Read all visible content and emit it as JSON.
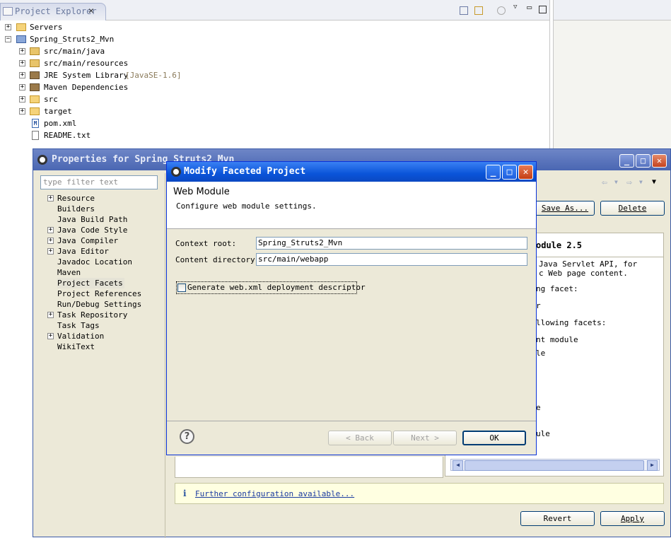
{
  "project_explorer": {
    "tab_label": "Project Explorer",
    "close_glyph": "✕",
    "tree": [
      {
        "label": "Servers",
        "icon": "folder-icon",
        "expander": "+"
      },
      {
        "label": "Spring_Struts2_Mvn",
        "icon": "project-icon",
        "expander": "−"
      },
      {
        "label": "src/main/java",
        "icon": "source-folder-icon",
        "expander": "+"
      },
      {
        "label": "src/main/resources",
        "icon": "source-folder-icon",
        "expander": "+"
      },
      {
        "label": "JRE System Library",
        "suffix": "[JavaSE-1.6]",
        "icon": "library-icon",
        "expander": "+"
      },
      {
        "label": "Maven Dependencies",
        "icon": "library-icon",
        "expander": "+"
      },
      {
        "label": "src",
        "icon": "folder-icon",
        "expander": "+"
      },
      {
        "label": "target",
        "icon": "folder-icon",
        "expander": "+"
      },
      {
        "label": "pom.xml",
        "icon": "maven-file-icon",
        "badge": "M"
      },
      {
        "label": "README.txt",
        "icon": "text-file-icon"
      }
    ]
  },
  "properties": {
    "title": "Properties for Spring_Struts2_Mvn",
    "filter_placeholder": "type filter text",
    "nav": [
      {
        "label": "Resource",
        "expander": "+"
      },
      {
        "label": "Builders"
      },
      {
        "label": "Java Build Path"
      },
      {
        "label": "Java Code Style",
        "expander": "+"
      },
      {
        "label": "Java Compiler",
        "expander": "+"
      },
      {
        "label": "Java Editor",
        "expander": "+"
      },
      {
        "label": "Javadoc Location"
      },
      {
        "label": "Maven"
      },
      {
        "label": "Project Facets",
        "selected": true
      },
      {
        "label": "Project References"
      },
      {
        "label": "Run/Debug Settings"
      },
      {
        "label": "Task Repository",
        "expander": "+"
      },
      {
        "label": "Task Tags"
      },
      {
        "label": "Validation",
        "expander": "+"
      },
      {
        "label": "WikiText"
      }
    ],
    "save_as_label": "Save As...",
    "delete_label": "Delete",
    "facet_heading": "odule 2.5",
    "facet_description": [
      "Java Servlet API, for",
      "c Web page content.",
      "ng facet:",
      "r",
      "llowing facets:",
      "nt module",
      "le",
      "e",
      "ule"
    ],
    "further_info_glyph": "i",
    "further_link": "Further configuration available...",
    "revert_label": "Revert",
    "apply_label": "Apply"
  },
  "modify_dialog": {
    "title": "Modify Faceted Project",
    "heading": "Web Module",
    "subheading": "Configure web module settings.",
    "context_root_label": "Context root:",
    "context_root_value": "Spring_Struts2_Mvn",
    "content_dir_label": "Content directory:",
    "content_dir_value": "src/main/webapp",
    "generate_label": "Generate web.xml deployment descriptor",
    "help_glyph": "?",
    "back_label": "< Back",
    "next_label": "Next >",
    "ok_label": "OK"
  }
}
